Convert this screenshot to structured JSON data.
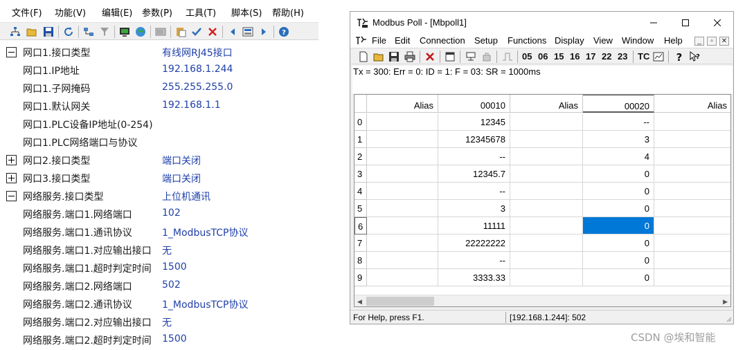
{
  "left": {
    "menu": [
      {
        "id": "file",
        "label": "文件(F)"
      },
      {
        "id": "function",
        "label": "功能(V)"
      },
      {
        "id": "edit",
        "label": "编辑(E)"
      },
      {
        "id": "params",
        "label": "参数(P)"
      },
      {
        "id": "tools",
        "label": "工具(T)"
      },
      {
        "id": "script",
        "label": "脚本(S)"
      },
      {
        "id": "help",
        "label": "帮助(H)"
      }
    ],
    "toolbar_icons": [
      "network-tree-icon",
      "open-folder-icon",
      "save-icon",
      "refresh-icon",
      "connect-icon",
      "filter-icon",
      "monitor-icon",
      "globe-icon",
      "module-icon",
      "paste-icon",
      "check-icon",
      "delete-x-icon",
      "arrow-left-icon",
      "data-block-icon",
      "arrow-right-icon",
      "help-icon"
    ],
    "properties": [
      {
        "expander": "minus",
        "name": "网口1.接口类型",
        "value": "有线网RJ45接口"
      },
      {
        "expander": "",
        "name": "网口1.IP地址",
        "value": "192.168.1.244"
      },
      {
        "expander": "",
        "name": "网口1.子网掩码",
        "value": "255.255.255.0"
      },
      {
        "expander": "",
        "name": "网口1.默认网关",
        "value": "192.168.1.1"
      },
      {
        "expander": "",
        "name": "网口1.PLC设备IP地址(0-254)",
        "value": ""
      },
      {
        "expander": "",
        "name": "网口1.PLC网络端口与协议",
        "value": ""
      },
      {
        "expander": "plus",
        "name": "网口2.接口类型",
        "value": "端口关闭"
      },
      {
        "expander": "plus",
        "name": "网口3.接口类型",
        "value": "端口关闭"
      },
      {
        "expander": "minus",
        "name": "网络服务.接口类型",
        "value": "上位机通讯"
      },
      {
        "expander": "",
        "name": "网络服务.端口1.网络端口",
        "value": "102"
      },
      {
        "expander": "",
        "name": "网络服务.端口1.通讯协议",
        "value": "1_ModbusTCP协议"
      },
      {
        "expander": "",
        "name": "网络服务.端口1.对应输出接口",
        "value": "无"
      },
      {
        "expander": "",
        "name": "网络服务.端口1.超时判定时间",
        "value": "1500"
      },
      {
        "expander": "",
        "name": "网络服务.端口2.网络端口",
        "value": "502"
      },
      {
        "expander": "",
        "name": "网络服务.端口2.通讯协议",
        "value": "1_ModbusTCP协议"
      },
      {
        "expander": "",
        "name": "网络服务.端口2.对应输出接口",
        "value": "无"
      },
      {
        "expander": "",
        "name": "网络服务.端口2.超时判定时间",
        "value": "1500"
      }
    ]
  },
  "mbpoll": {
    "title": "Modbus Poll - [Mbpoll1]",
    "menu": [
      "File",
      "Edit",
      "Connection",
      "Setup",
      "Functions",
      "Display",
      "View",
      "Window",
      "Help"
    ],
    "mdi_controls": [
      "_",
      "▫",
      "✕"
    ],
    "toolbar_func_codes": [
      "05",
      "06",
      "15",
      "16",
      "17",
      "22",
      "23"
    ],
    "toolbar_tc": "TC",
    "status_line": "Tx = 300: Err = 0: ID = 1: F = 03: SR = 1000ms",
    "columns": [
      "Alias",
      "00010",
      "Alias",
      "00020",
      "Alias"
    ],
    "row_labels": [
      "0",
      "1",
      "2",
      "3",
      "4",
      "5",
      "6",
      "7",
      "8",
      "9"
    ],
    "col1_values": [
      "12345",
      "12345678",
      "--",
      "12345.7",
      "--",
      "3",
      "11111",
      "22222222",
      "--",
      "3333.33"
    ],
    "col3_values": [
      "--",
      "3",
      "4",
      "0",
      "0",
      "0",
      "0",
      "0",
      "0",
      "0"
    ],
    "selected_row": 6,
    "statusbar_help": "For Help, press F1.",
    "statusbar_conn": "[192.168.1.244]: 502"
  },
  "watermark": "CSDN @埃和智能"
}
